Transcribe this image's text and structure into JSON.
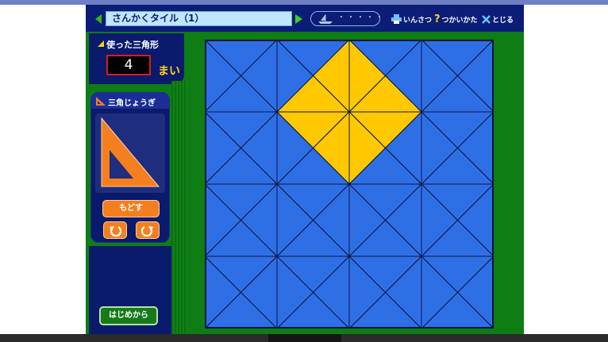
{
  "toolbar": {
    "title": "さんかくタイル（1）",
    "progress_dots": "・・・・・",
    "print_label": "いんさつ",
    "help_label": "つかいかた",
    "close_label": "とじる"
  },
  "counter": {
    "caption": "使った三角形",
    "value": "4",
    "unit": "まい"
  },
  "ruler": {
    "title": "三角じょうぎ",
    "back_label": "もどす"
  },
  "restart_label": "はじめから",
  "colors": {
    "tile_blue": "#2f6fe6",
    "tile_yellow": "#ffc800",
    "orange": "#f57f1f",
    "panel_navy": "#0a1a6c",
    "background_green": "#0d7d14"
  },
  "board": {
    "grid": "4x4",
    "filled_triangles": [
      {
        "cell": [
          1,
          0
        ],
        "triangle": "bottom"
      },
      {
        "cell": [
          2,
          0
        ],
        "triangle": "bottom"
      },
      {
        "cell": [
          1,
          1
        ],
        "triangle": "top"
      },
      {
        "cell": [
          2,
          1
        ],
        "triangle": "top"
      },
      {
        "cell": [
          1,
          0
        ],
        "triangle": "right"
      },
      {
        "cell": [
          2,
          0
        ],
        "triangle": "left"
      },
      {
        "cell": [
          1,
          1
        ],
        "triangle": "right"
      },
      {
        "cell": [
          2,
          1
        ],
        "triangle": "left"
      }
    ]
  }
}
